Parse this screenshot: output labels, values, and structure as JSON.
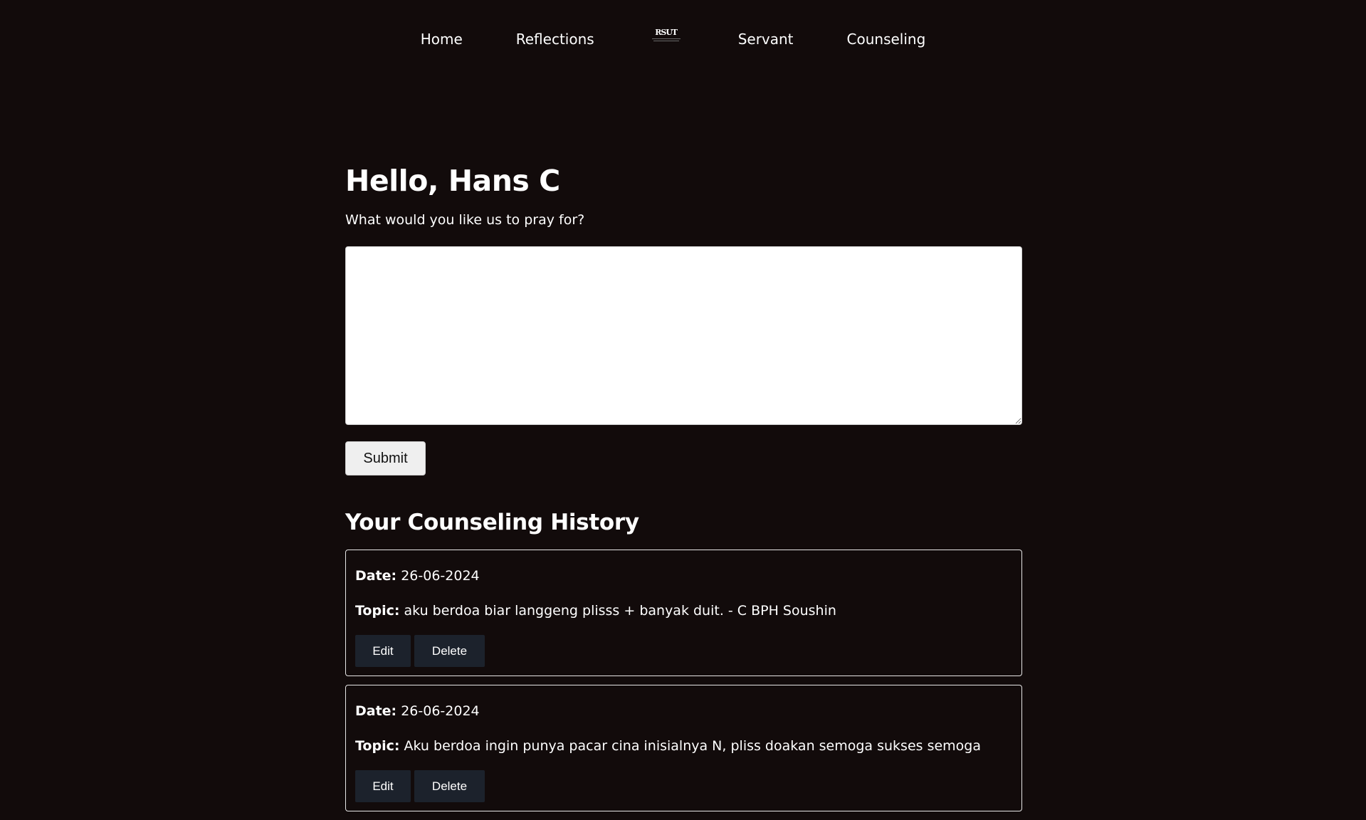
{
  "nav": {
    "items": [
      {
        "label": "Home"
      },
      {
        "label": "Reflections"
      },
      {
        "label": "Servant"
      },
      {
        "label": "Counseling"
      }
    ],
    "logo_text": "RSUT",
    "logo_icon": "site-logo-icon"
  },
  "main": {
    "greeting": "Hello, Hans C",
    "prompt": "What would you like us to pray for?",
    "prayer_input": {
      "value": "",
      "placeholder": ""
    },
    "submit_label": "Submit"
  },
  "history": {
    "title": "Your Counseling History",
    "date_label": "Date:",
    "topic_label": "Topic:",
    "edit_label": "Edit",
    "delete_label": "Delete",
    "entries": [
      {
        "date": "26-06-2024",
        "topic": "aku berdoa biar langgeng plisss + banyak duit. - C BPH Soushin"
      },
      {
        "date": "26-06-2024",
        "topic": "Aku berdoa ingin punya pacar cina inisialnya N, pliss doakan semoga sukses semoga"
      }
    ]
  },
  "colors": {
    "background": "#120b0b",
    "text": "#ffffff",
    "action_button": "#1c222c"
  }
}
